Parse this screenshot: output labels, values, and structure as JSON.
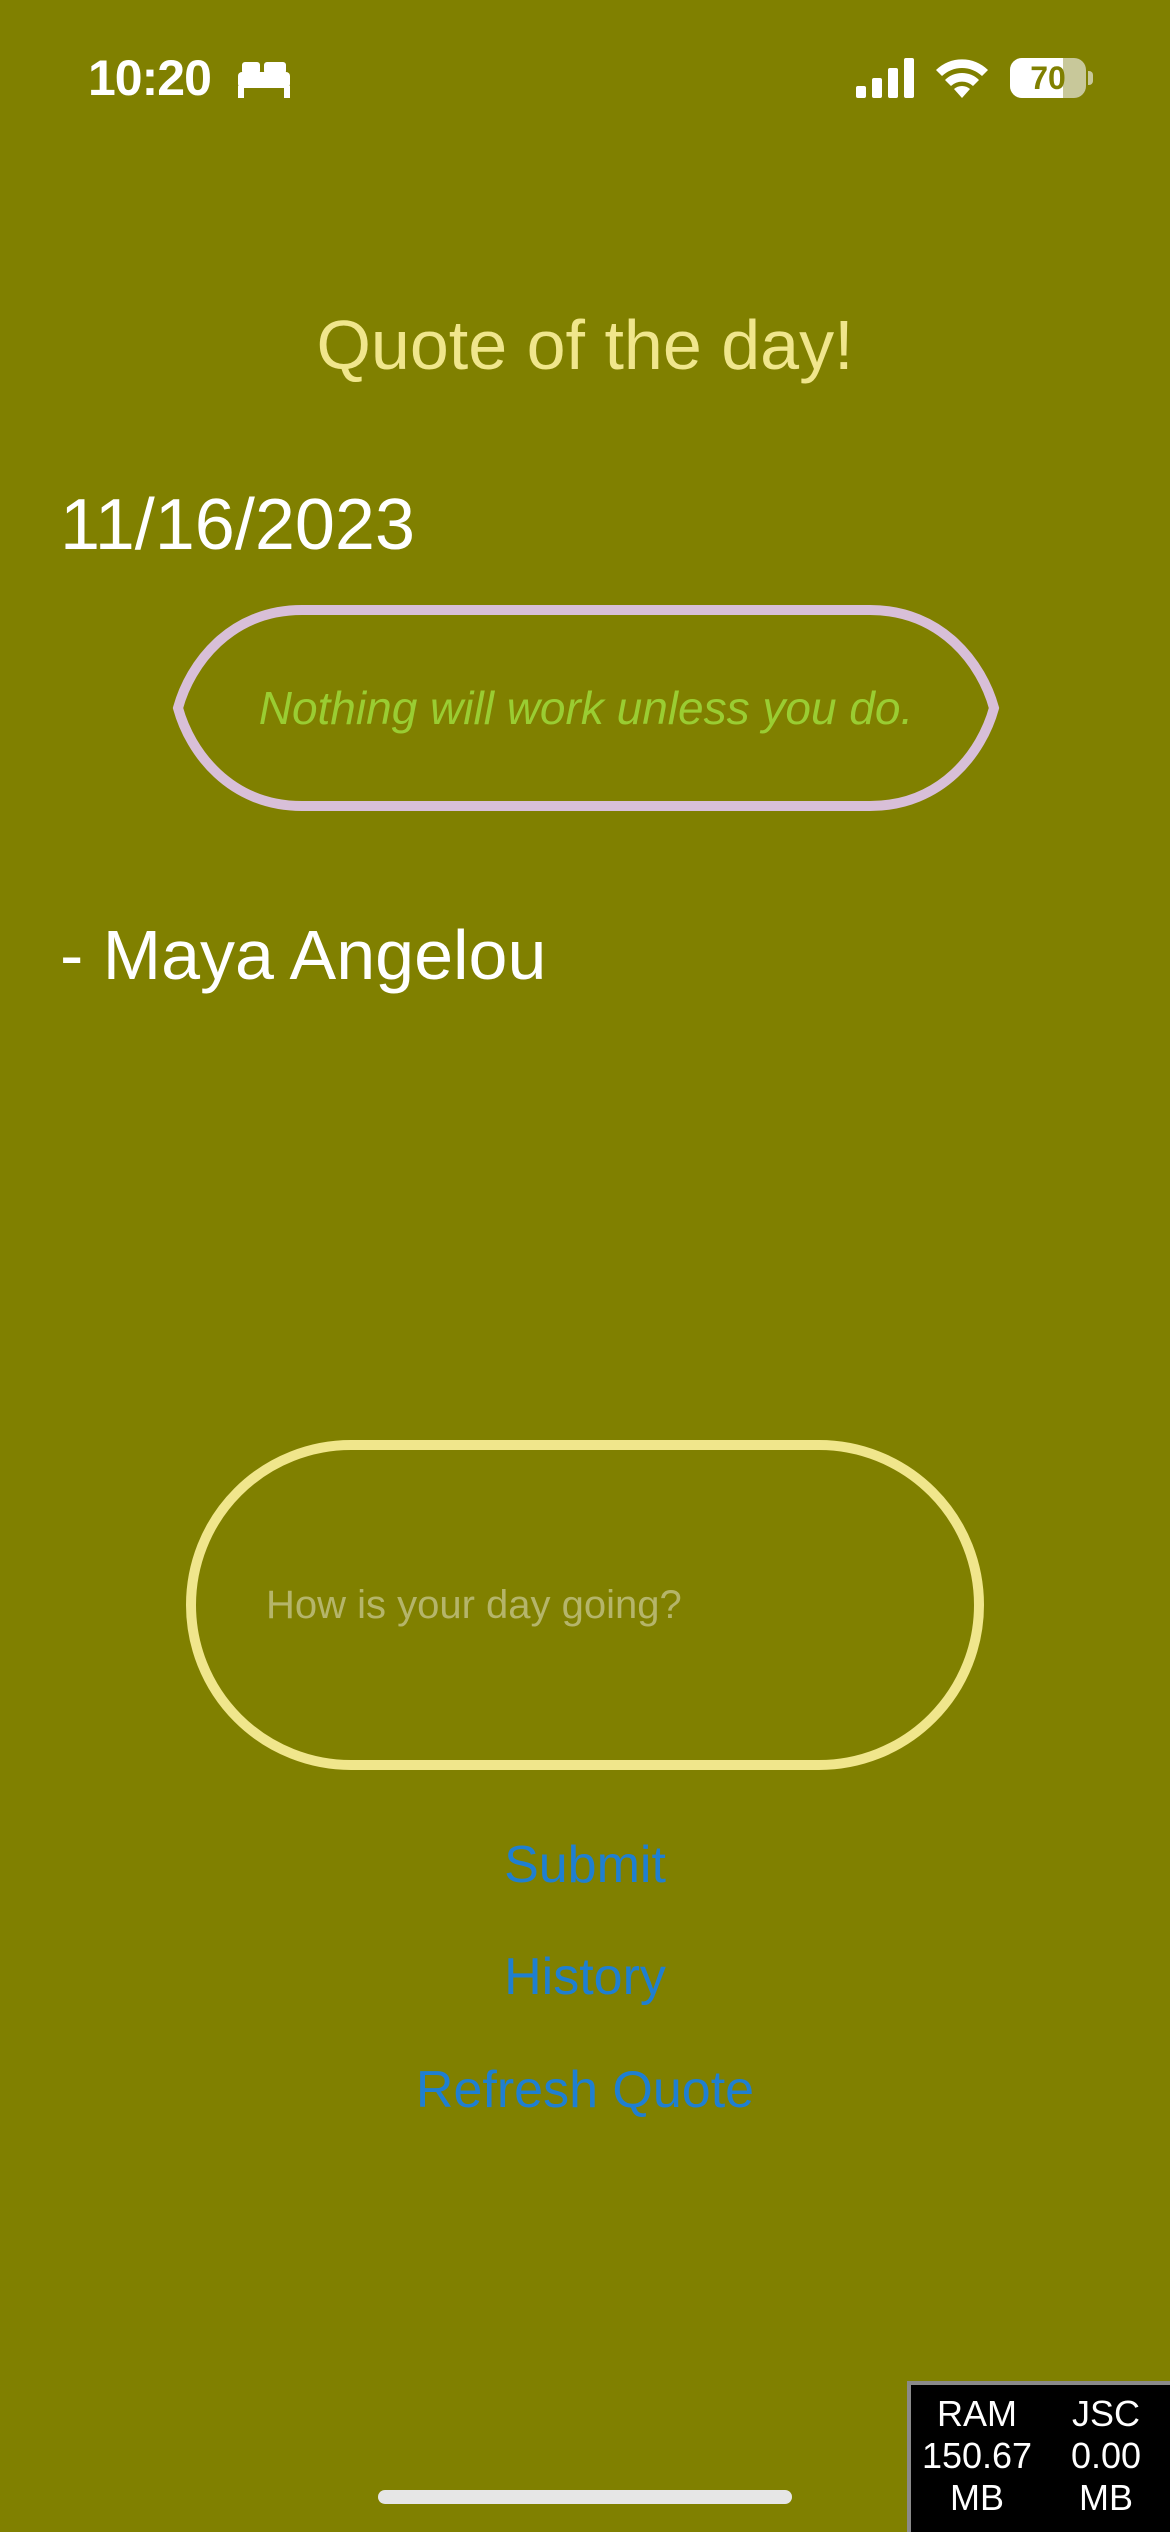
{
  "status_bar": {
    "time": "10:20",
    "sleep_icon": "bed-icon",
    "signal_icon": "cellular-signal-icon",
    "wifi_icon": "wifi-icon",
    "battery_level": "70",
    "battery_fraction": 0.7
  },
  "header": {
    "title": "Quote of the day!"
  },
  "quote": {
    "date": "11/16/2023",
    "text": "Nothing will work unless you do.",
    "author": "- Maya Angelou"
  },
  "journal": {
    "placeholder": "How is your day going?",
    "value": ""
  },
  "actions": {
    "submit_label": "Submit",
    "history_label": "History",
    "refresh_label": "Refresh Quote"
  },
  "perf_monitor": {
    "ram_label": "RAM",
    "ram_value": "150.67",
    "ram_unit": "MB",
    "jsc_label": "JSC",
    "jsc_value": "0.00",
    "jsc_unit": "MB"
  },
  "colors": {
    "background": "#808000",
    "title": "#f0e68c",
    "quote_text": "#9acd32",
    "quote_border": "#d8bfd8",
    "input_border": "#f0e68c",
    "link": "#1f7fd1"
  }
}
